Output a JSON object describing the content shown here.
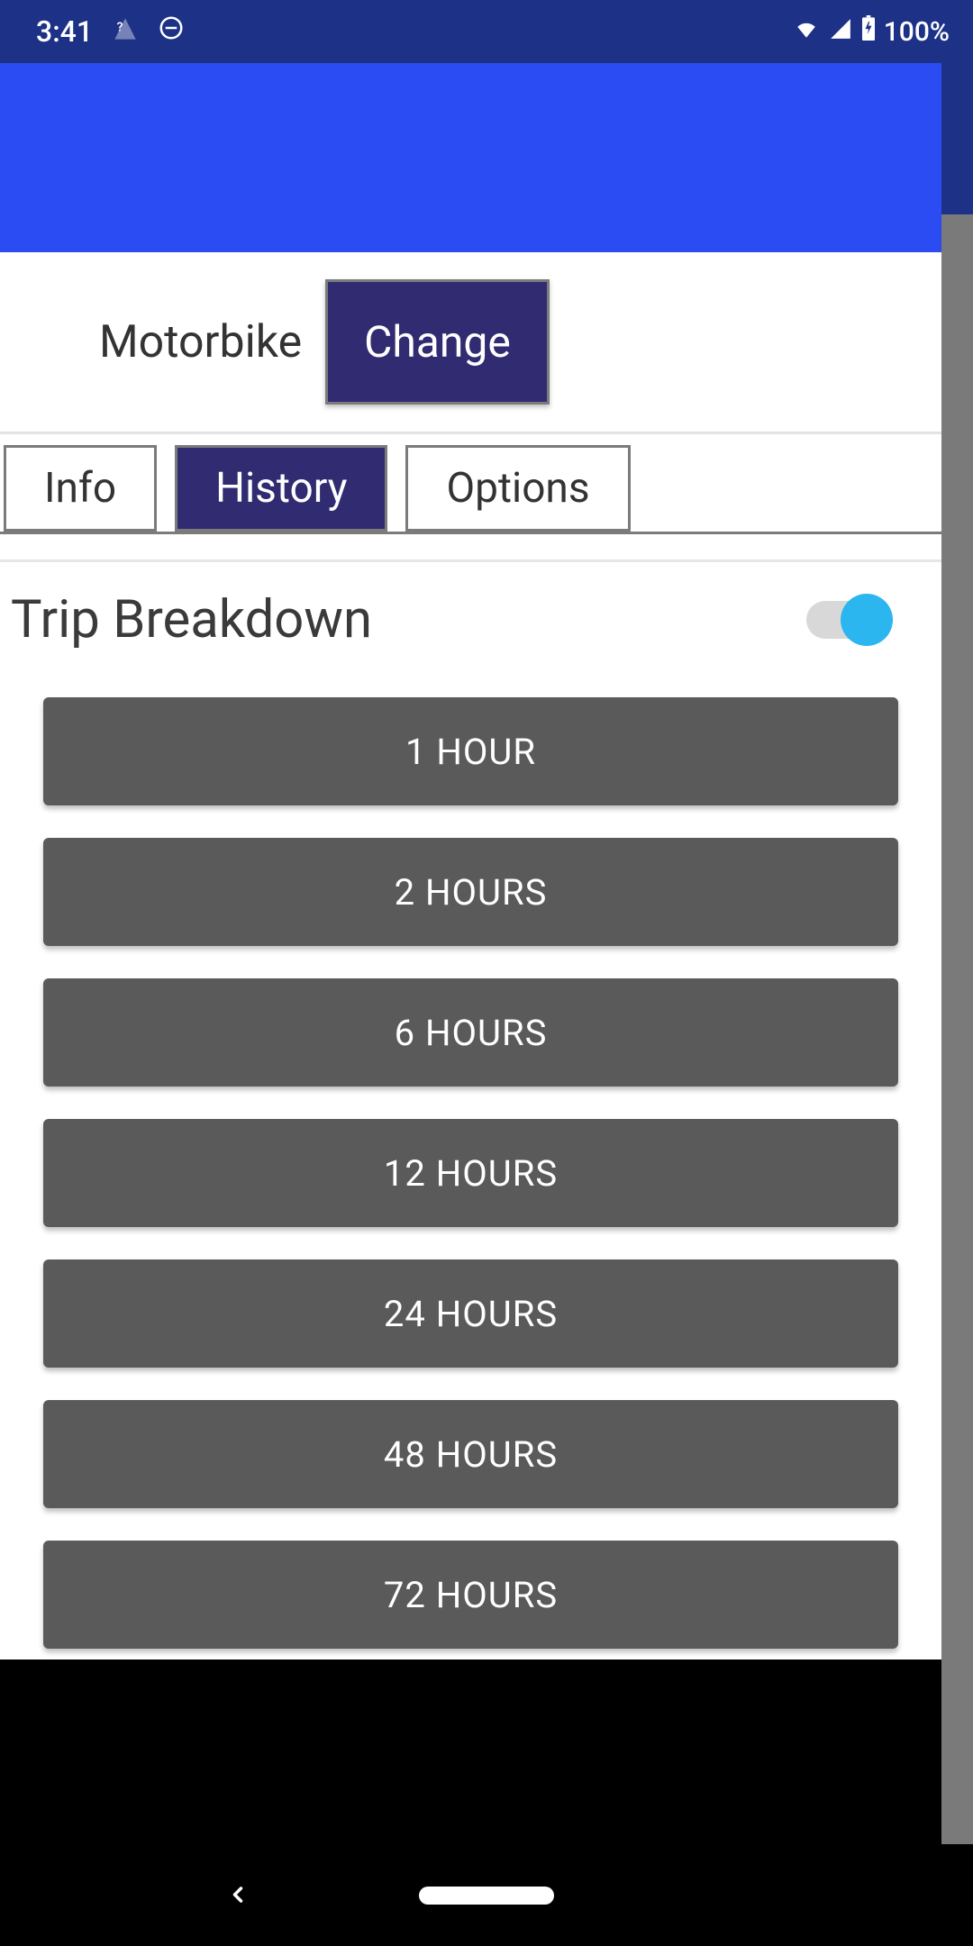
{
  "status": {
    "time": "3:41",
    "battery": "100%"
  },
  "vehicle": {
    "label": "Motorbike",
    "change_label": "Change"
  },
  "tabs": {
    "info": "Info",
    "history": "History",
    "options": "Options",
    "active": "history"
  },
  "section": {
    "title": "Trip Breakdown",
    "enabled": true
  },
  "hours": [
    "1 HOUR",
    "2 HOURS",
    "6 HOURS",
    "12 HOURS",
    "24 HOURS",
    "48 HOURS",
    "72 HOURS"
  ]
}
